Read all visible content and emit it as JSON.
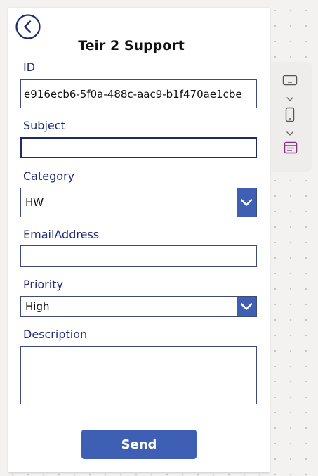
{
  "form": {
    "title": "Teir 2 Support",
    "fields": {
      "id": {
        "label": "ID",
        "value": "e916ecb6-5f0a-488c-aac9-b1f470ae1cbe"
      },
      "subject": {
        "label": "Subject",
        "value": ""
      },
      "category": {
        "label": "Category",
        "value": "HW"
      },
      "email": {
        "label": "EmailAddress",
        "value": ""
      },
      "priority": {
        "label": "Priority",
        "value": "High"
      },
      "description": {
        "label": "Description",
        "value": ""
      }
    },
    "send_label": "Send"
  },
  "icons": {
    "back": "back-arrow-circle-icon",
    "dropdown": "chevron-down-icon",
    "side_panel": [
      "tablet-layout-icon",
      "chevron-down-icon",
      "phone-layout-icon",
      "chevron-down-icon",
      "form-layout-icon"
    ]
  },
  "colors": {
    "accent": "#3f5fb5",
    "label": "#1f2a7a",
    "border": "#3b4b7c",
    "focus_border": "#1c2c6a",
    "side_active": "#8a2d86"
  }
}
